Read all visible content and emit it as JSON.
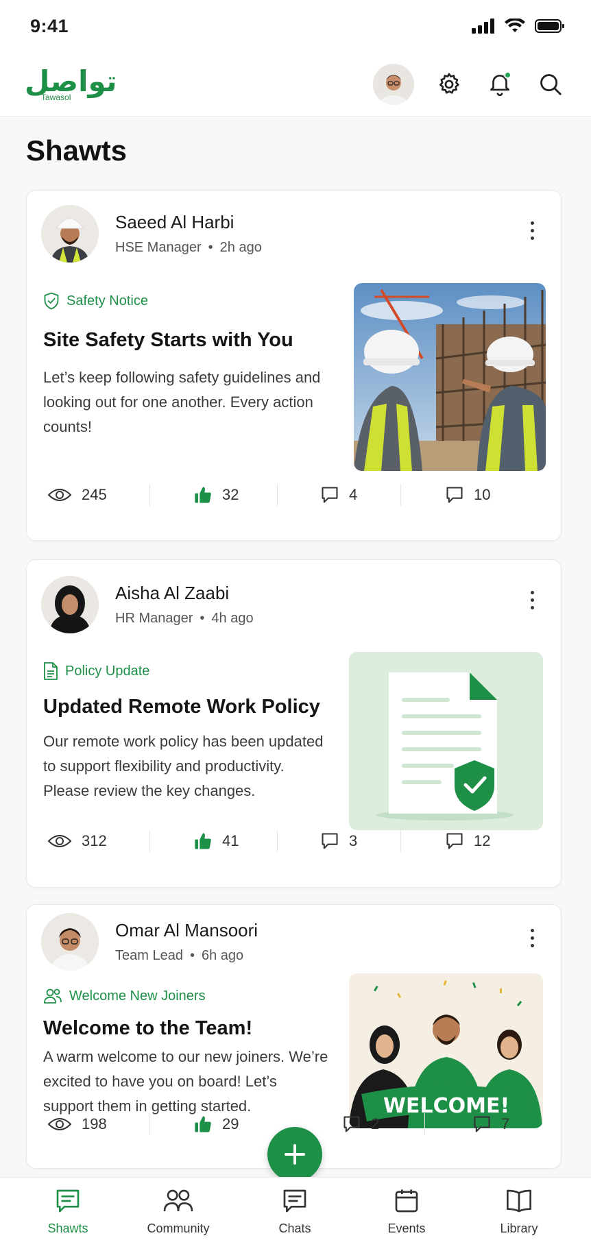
{
  "status_bar": {
    "time": "9:41"
  },
  "header": {
    "logo_ar": "تواصل",
    "logo_en": "Tawasol"
  },
  "page": {
    "title": "Shawts"
  },
  "posts": [
    {
      "author": "Saeed Al Harbi",
      "role": "HSE Manager",
      "time": "2h ago",
      "tag": "Safety Notice",
      "tag_icon": "shield-check-icon",
      "title": "Site Safety Starts with You",
      "body": "Let’s keep following safety guidelines and looking out for one another. Every action counts!",
      "stats": {
        "views": "245",
        "likes": "32",
        "comments": "4",
        "replies": "10"
      }
    },
    {
      "author": "Aisha Al Zaabi",
      "role": "HR Manager",
      "time": "4h ago",
      "tag": "Policy Update",
      "tag_icon": "document-icon",
      "title": "Updated Remote Work Policy",
      "body": "Our remote work policy has been updated to support flexibility and productivity. Please review the key changes.",
      "stats": {
        "views": "312",
        "likes": "41",
        "comments": "3",
        "replies": "12"
      }
    },
    {
      "author": "Omar Al Mansoori",
      "role": "Team Lead",
      "time": "6h ago",
      "tag": "Welcome New Joiners",
      "tag_icon": "users-icon",
      "title": "Welcome to the Team!",
      "body": "A warm welcome to our new joiners. We’re excited to have you on board! Let’s support them in getting started.",
      "banner_text": "WELCOME!",
      "stats": {
        "views": "198",
        "likes": "29",
        "comments": "2",
        "replies": "7"
      }
    }
  ],
  "nav": [
    {
      "label": "Shawts",
      "icon": "shawts-icon",
      "active": true
    },
    {
      "label": "Community",
      "icon": "community-icon",
      "active": false
    },
    {
      "label": "Chats",
      "icon": "chat-icon",
      "active": false
    },
    {
      "label": "Events",
      "icon": "calendar-icon",
      "active": false
    },
    {
      "label": "Library",
      "icon": "book-icon",
      "active": false
    }
  ],
  "colors": {
    "brand": "#1e8f47",
    "accent_dot": "#22a554"
  }
}
